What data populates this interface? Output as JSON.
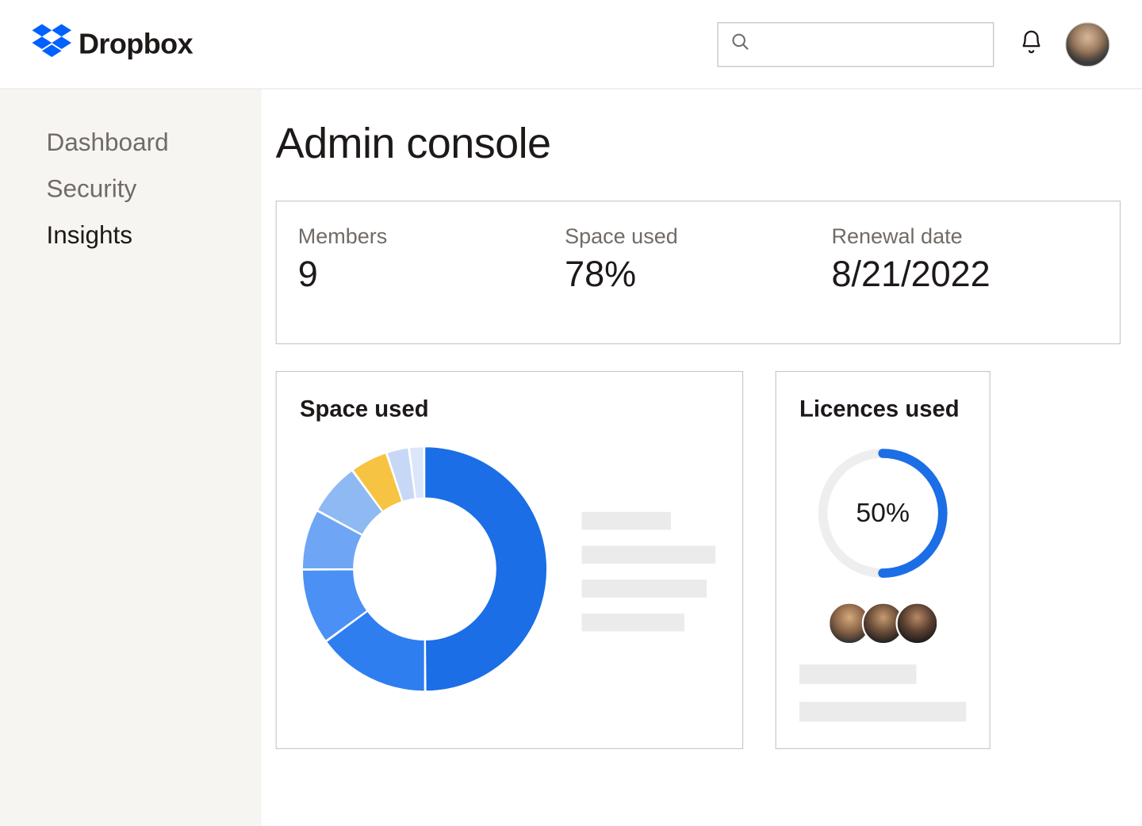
{
  "brand": {
    "name": "Dropbox"
  },
  "search": {
    "placeholder": ""
  },
  "sidebar": {
    "items": [
      {
        "label": "Dashboard",
        "active": false
      },
      {
        "label": "Security",
        "active": false
      },
      {
        "label": "Insights",
        "active": true
      }
    ]
  },
  "page": {
    "title": "Admin console"
  },
  "stats": {
    "members": {
      "label": "Members",
      "value": "9"
    },
    "space_used": {
      "label": "Space used",
      "value": "78%"
    },
    "renewal_date": {
      "label": "Renewal date",
      "value": "8/21/2022"
    }
  },
  "space_card": {
    "title": "Space used"
  },
  "licences_card": {
    "title": "Licences used",
    "percent_label": "50%",
    "percent": 50
  },
  "chart_data": [
    {
      "type": "pie",
      "title": "Space used",
      "series": [
        {
          "name": "segment-1",
          "value": 50,
          "color": "#1b6ee6"
        },
        {
          "name": "segment-2",
          "value": 15,
          "color": "#2f7ef0"
        },
        {
          "name": "segment-3",
          "value": 10,
          "color": "#4b90f4"
        },
        {
          "name": "segment-4",
          "value": 8,
          "color": "#6ea6f5"
        },
        {
          "name": "segment-5",
          "value": 7,
          "color": "#8fb9f3"
        },
        {
          "name": "segment-6",
          "value": 5,
          "color": "#f6c342"
        },
        {
          "name": "segment-7",
          "value": 3,
          "color": "#c7d8f7"
        },
        {
          "name": "segment-8",
          "value": 2,
          "color": "#dbe6fb"
        }
      ],
      "inner_radius_ratio": 0.58
    },
    {
      "type": "pie",
      "title": "Licences used",
      "series": [
        {
          "name": "used",
          "value": 50,
          "color": "#1b6ee6"
        },
        {
          "name": "unused",
          "value": 50,
          "color": "#eeeeee"
        }
      ],
      "inner_radius_ratio": 0.88,
      "center_label": "50%"
    }
  ]
}
